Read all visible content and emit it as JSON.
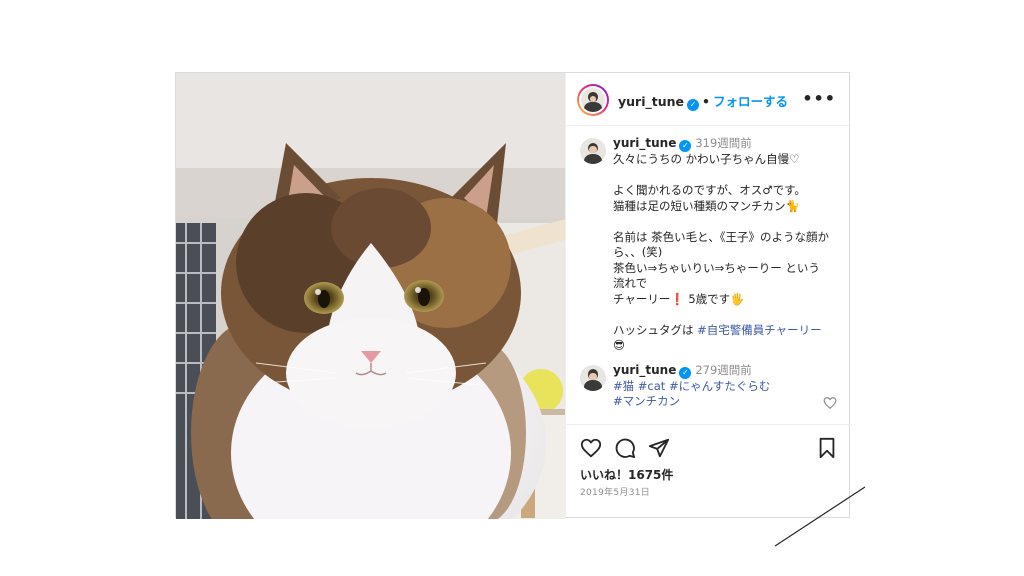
{
  "header": {
    "username": "yuri_tune",
    "verified_mark": "✓",
    "separator": "•",
    "follow_label": "フォローする",
    "more_label": "•••"
  },
  "caption": {
    "username": "yuri_tune",
    "time": "319週間前",
    "lines": [
      "久々にうちの かわい子ちゃん自慢♡",
      "",
      "よく聞かれるのですが、オス♂です。",
      "猫種は足の短い種類のマンチカン🐈",
      "",
      "名前は 茶色い毛と、《王子》のような顔か",
      "ら、、(笑)",
      "茶色い⇒ちゃいりい⇒ちゃーりー という",
      "流れで",
      "チャーリー❗ 5歳です🖐"
    ],
    "hashtag_prefix": "ハッシュタグは ",
    "hashtag": "#自宅警備員チャーリー",
    "trailing_emoji": "😎"
  },
  "reply": {
    "username": "yuri_tune",
    "time": "279週間前",
    "line1": [
      "#猫",
      "#cat",
      "#にゃんすたぐらむ"
    ],
    "line2": [
      "#マンチカン"
    ]
  },
  "actions": {
    "like_icon": "heart-icon",
    "comment_icon": "comment-icon",
    "share_icon": "share-icon",
    "save_icon": "bookmark-icon"
  },
  "likes_text": "いいね！1675件",
  "date_text": "2019年5月31日",
  "colors": {
    "link_blue": "#0095f6",
    "hashtag_blue": "#3c5aa6",
    "muted_gray": "#8e8e8e",
    "border": "#dbdbdb"
  }
}
